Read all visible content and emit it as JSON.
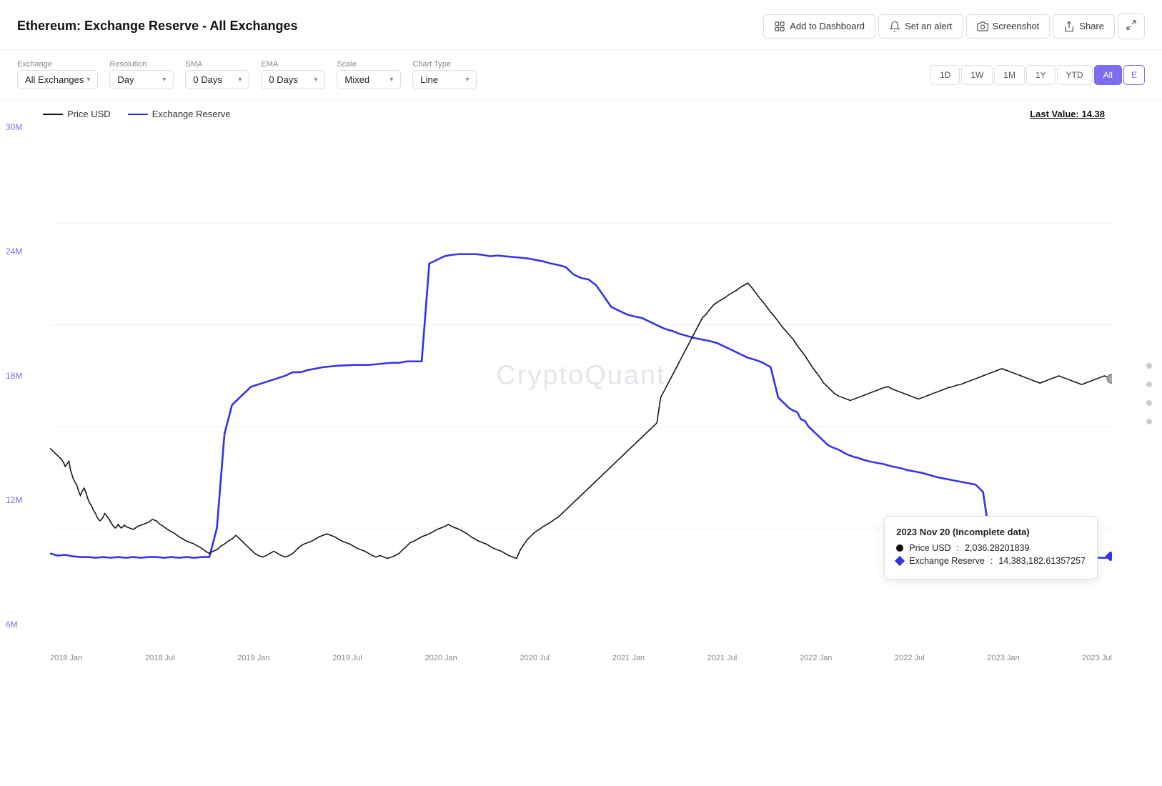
{
  "header": {
    "title": "Ethereum: Exchange Reserve - All Exchanges",
    "actions": {
      "add_dashboard": "Add to Dashboard",
      "set_alert": "Set an alert",
      "screenshot": "Screenshot",
      "share": "Share"
    }
  },
  "controls": {
    "exchange": {
      "label": "Exchange",
      "value": "All Exchanges"
    },
    "resolution": {
      "label": "Resolution",
      "value": "Day"
    },
    "sma": {
      "label": "SMA",
      "value": "0 Days"
    },
    "ema": {
      "label": "EMA",
      "value": "0 Days"
    },
    "scale": {
      "label": "Scale",
      "value": "Mixed"
    },
    "chart_type": {
      "label": "Chart Type",
      "value": "Line"
    }
  },
  "time_range": {
    "buttons": [
      "1D",
      "1W",
      "1M",
      "1Y",
      "YTD",
      "All"
    ],
    "active": "All",
    "extra": "E"
  },
  "chart": {
    "watermark": "CryptoQuant",
    "legend": {
      "price_label": "Price USD",
      "reserve_label": "Exchange Reserve"
    },
    "last_value": "Last Value: 14.38",
    "y_axis": [
      "30M",
      "24M",
      "18M",
      "12M",
      "6M"
    ],
    "x_axis": [
      "2018 Jan",
      "2018 Jul",
      "2019 Jan",
      "2019 Jul",
      "2020 Jan",
      "2020 Jul",
      "2021 Jan",
      "2021 Jul",
      "2022 Jan",
      "2022 Jul",
      "2023 Jan",
      "2023 Jul"
    ]
  },
  "tooltip": {
    "date": "2023 Nov 20 (Incomplete data)",
    "price_label": "Price USD",
    "price_value": "2,036.28201839",
    "reserve_label": "Exchange Reserve",
    "reserve_value": "14,383,182.61357257"
  },
  "icons": {
    "dashboard": "grid-icon",
    "alert": "bell-icon",
    "screenshot": "camera-icon",
    "share": "share-icon",
    "fullscreen": "fullscreen-icon"
  }
}
